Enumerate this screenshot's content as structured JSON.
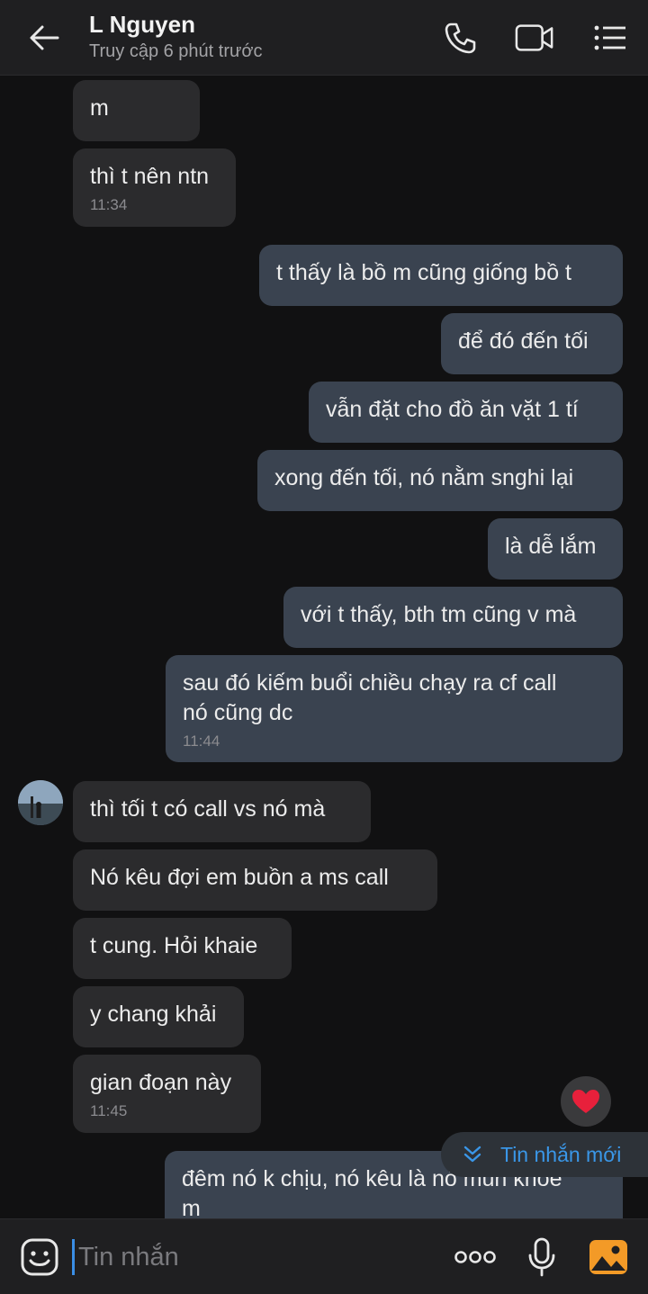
{
  "header": {
    "title": "L Nguyen",
    "status": "Truy cập 6 phút trước"
  },
  "messages": [
    {
      "text": "m"
    },
    {
      "text": "thì t nên ntn",
      "time": "11:34"
    },
    {
      "text": "t thấy là bồ m cũng giống bồ t"
    },
    {
      "text": "để đó đến tối"
    },
    {
      "text": "vẫn đặt cho đồ ăn vặt 1 tí"
    },
    {
      "text": "xong đến tối, nó nằm snghi lại"
    },
    {
      "text": "là dễ lắm"
    },
    {
      "text": "với t thấy, bth tm cũng v mà"
    },
    {
      "text": "sau đó kiếm buổi chiều chạy ra cf call",
      "text2": "nó cũng dc",
      "time": "11:44"
    },
    {
      "text": "thì tối t có call vs nó mà"
    },
    {
      "text": "Nó kêu đợi em buồn a ms call"
    },
    {
      "text": "t cung. Hỏi khaie"
    },
    {
      "text": "y chang khải"
    },
    {
      "text": "gian đoạn này",
      "time": "11:45"
    },
    {
      "text": "đêm nó k chịu, nó kêu là nó mún khoe",
      "text2": "m"
    }
  ],
  "reaction": {
    "icon": "heart-icon",
    "color": "#e8203b"
  },
  "new_messages": {
    "label": "Tin nhắn mới",
    "icon": "double-chevron-down-icon"
  },
  "composer": {
    "placeholder": "Tin nhắn",
    "accent": "#3a8ee6"
  },
  "colors": {
    "background": "#111112",
    "incoming_bubble": "#2b2b2d",
    "outgoing_bubble": "#3a4350",
    "link_blue": "#3a97e8"
  }
}
